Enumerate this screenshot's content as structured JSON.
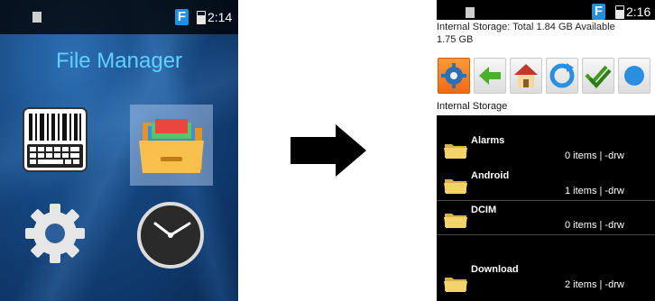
{
  "left_phone": {
    "status_bar": {
      "time": "2:14",
      "f_badge": "F"
    },
    "title": "File Manager",
    "apps": [
      {
        "icon": "barcode-keyboard-icon"
      },
      {
        "icon": "file-manager-icon",
        "selected": true
      },
      {
        "icon": "settings-gear-icon"
      },
      {
        "icon": "clock-icon"
      }
    ]
  },
  "right_phone": {
    "status_bar": {
      "time": "2:16",
      "f_badge": "F"
    },
    "storage_line1": "Internal Storage:  Total 1.84 GB    Available",
    "storage_line2": "1.75 GB",
    "toolbar": [
      {
        "icon": "settings-icon",
        "active": true
      },
      {
        "icon": "back-arrow-icon"
      },
      {
        "icon": "home-icon"
      },
      {
        "icon": "refresh-icon"
      },
      {
        "icon": "select-all-check-icon"
      },
      {
        "icon": "info-icon"
      }
    ],
    "path": "Internal Storage",
    "folders": [
      {
        "name": "Alarms",
        "meta": "0 items | -drw"
      },
      {
        "name": "Android",
        "meta": "1 items | -drw"
      },
      {
        "name": "DCIM",
        "meta": "0 items | -drw"
      },
      {
        "name": "Download",
        "meta": "2 items | -drw"
      }
    ]
  },
  "colors": {
    "title_cyan": "#5fd1ff",
    "folder_yellow": "#f3d46b",
    "active_orange": "#f07a1a"
  }
}
